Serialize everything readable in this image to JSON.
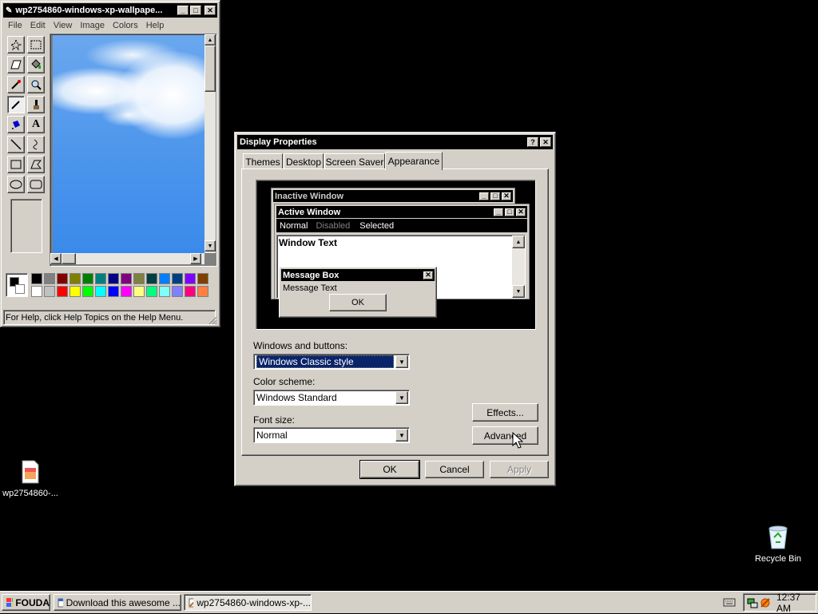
{
  "paint": {
    "title": "wp2754860-windows-xp-wallpape...",
    "menu": [
      "File",
      "Edit",
      "View",
      "Image",
      "Colors",
      "Help"
    ],
    "status": "For Help, click Help Topics on the Help Menu.",
    "palette_top": [
      "#000000",
      "#808080",
      "#800000",
      "#808000",
      "#008000",
      "#008080",
      "#000080",
      "#800080",
      "#808040",
      "#004040",
      "#0080ff",
      "#004080",
      "#8000ff",
      "#804000"
    ],
    "palette_bottom": [
      "#ffffff",
      "#c0c0c0",
      "#ff0000",
      "#ffff00",
      "#00ff00",
      "#00ffff",
      "#0000ff",
      "#ff00ff",
      "#ffff80",
      "#00ff80",
      "#80ffff",
      "#8080ff",
      "#ff0080",
      "#ff8040"
    ]
  },
  "display": {
    "title": "Display Properties",
    "tabs": [
      "Themes",
      "Desktop",
      "Screen Saver",
      "Appearance"
    ],
    "active_tab": "Appearance",
    "preview": {
      "inactive_title": "Inactive Window",
      "active_title": "Active Window",
      "menu_normal": "Normal",
      "menu_disabled": "Disabled",
      "menu_selected": "Selected",
      "window_text": "Window Text",
      "msgbox_title": "Message Box",
      "msgbox_text": "Message Text",
      "msgbox_ok": "OK"
    },
    "windows_buttons_label": "Windows and buttons:",
    "windows_buttons_value": "Windows Classic style",
    "color_scheme_label": "Color scheme:",
    "color_scheme_value": "Windows Standard",
    "font_size_label": "Font size:",
    "font_size_value": "Normal",
    "effects_btn": "Effects...",
    "advanced_btn": "Advanced",
    "ok_btn": "OK",
    "cancel_btn": "Cancel",
    "apply_btn": "Apply"
  },
  "desktop": {
    "file_icon_label": "wp2754860-...",
    "recycle_label": "Recycle Bin"
  },
  "taskbar": {
    "start_label": "FOUDA",
    "tasks": [
      "Download this awesome ...",
      "wp2754860-windows-xp-..."
    ],
    "clock": "12:37 AM"
  }
}
